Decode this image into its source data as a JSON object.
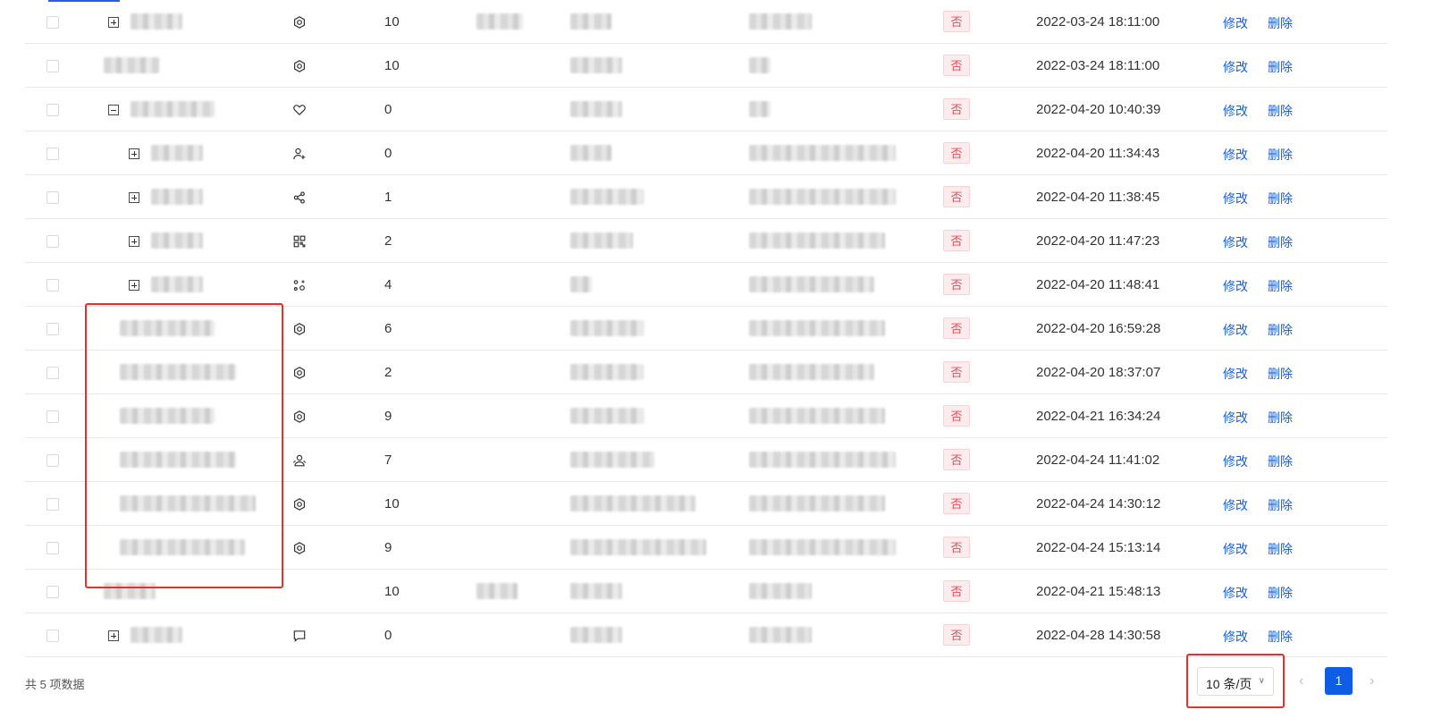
{
  "table": {
    "rows": [
      {
        "indent": 0,
        "expander": "plus",
        "icon": "settings-hex-icon",
        "num": "10",
        "badge": "否",
        "time": "2022-03-24 18:11:00",
        "edit": "修改",
        "del": "删除",
        "w1": 58,
        "w2": 52,
        "w3": 46,
        "w4": 70
      },
      {
        "indent": 0,
        "expander": "none",
        "icon": "settings-hex-icon",
        "num": "10",
        "badge": "否",
        "time": "2022-03-24 18:11:00",
        "edit": "修改",
        "del": "删除",
        "w1": 62,
        "w2": 0,
        "w3": 58,
        "w4": 24
      },
      {
        "indent": 0,
        "expander": "minus",
        "icon": "heart-icon",
        "num": "0",
        "badge": "否",
        "time": "2022-04-20 10:40:39",
        "edit": "修改",
        "del": "删除",
        "w1": 94,
        "w2": 0,
        "w3": 58,
        "w4": 24
      },
      {
        "indent": 1,
        "expander": "plus",
        "icon": "user-add-icon",
        "num": "0",
        "badge": "否",
        "time": "2022-04-20 11:34:43",
        "edit": "修改",
        "del": "删除",
        "w1": 58,
        "w2": 0,
        "w3": 46,
        "w4": 164
      },
      {
        "indent": 1,
        "expander": "plus",
        "icon": "share-icon",
        "num": "1",
        "badge": "否",
        "time": "2022-04-20 11:38:45",
        "edit": "修改",
        "del": "删除",
        "w1": 58,
        "w2": 0,
        "w3": 82,
        "w4": 164
      },
      {
        "indent": 1,
        "expander": "plus",
        "icon": "qrcode-icon",
        "num": "2",
        "badge": "否",
        "time": "2022-04-20 11:47:23",
        "edit": "修改",
        "del": "删除",
        "w1": 58,
        "w2": 0,
        "w3": 70,
        "w4": 152
      },
      {
        "indent": 1,
        "expander": "plus",
        "icon": "nodes-icon",
        "num": "4",
        "badge": "否",
        "time": "2022-04-20 11:48:41",
        "edit": "修改",
        "del": "删除",
        "w1": 58,
        "w2": 0,
        "w3": 24,
        "w4": 140
      },
      {
        "indent": 0,
        "expander": "none",
        "icon": "settings-hex-icon",
        "num": "6",
        "badge": "否",
        "time": "2022-04-20 16:59:28",
        "edit": "修改",
        "del": "删除",
        "w1": 106,
        "w2": 0,
        "w3": 82,
        "w4": 152
      },
      {
        "indent": 0,
        "expander": "none",
        "icon": "settings-hex-icon",
        "num": "2",
        "badge": "否",
        "time": "2022-04-20 18:37:07",
        "edit": "修改",
        "del": "删除",
        "w1": 130,
        "w2": 0,
        "w3": 82,
        "w4": 140
      },
      {
        "indent": 0,
        "expander": "none",
        "icon": "settings-hex-icon",
        "num": "9",
        "badge": "否",
        "time": "2022-04-21 16:34:24",
        "edit": "修改",
        "del": "删除",
        "w1": 106,
        "w2": 0,
        "w3": 82,
        "w4": 152
      },
      {
        "indent": 0,
        "expander": "none",
        "icon": "user-group-icon",
        "num": "7",
        "badge": "否",
        "time": "2022-04-24 11:41:02",
        "edit": "修改",
        "del": "删除",
        "w1": 130,
        "w2": 0,
        "w3": 94,
        "w4": 164
      },
      {
        "indent": 0,
        "expander": "none",
        "icon": "settings-hex-icon",
        "num": "10",
        "badge": "否",
        "time": "2022-04-24 14:30:12",
        "edit": "修改",
        "del": "删除",
        "w1": 152,
        "w2": 0,
        "w3": 140,
        "w4": 152
      },
      {
        "indent": 0,
        "expander": "none",
        "icon": "settings-hex-icon",
        "num": "9",
        "badge": "否",
        "time": "2022-04-24 15:13:14",
        "edit": "修改",
        "del": "删除",
        "w1": 140,
        "w2": 0,
        "w3": 152,
        "w4": 164
      },
      {
        "indent": 0,
        "expander": "none",
        "icon": "none",
        "num": "10",
        "badge": "否",
        "time": "2022-04-21 15:48:13",
        "edit": "修改",
        "del": "删除",
        "w1": 58,
        "w2": 46,
        "w3": 58,
        "w4": 70
      },
      {
        "indent": 0,
        "expander": "plus",
        "icon": "comment-icon",
        "num": "0",
        "badge": "否",
        "time": "2022-04-28 14:30:58",
        "edit": "修改",
        "del": "删除",
        "w1": 58,
        "w2": 0,
        "w3": 58,
        "w4": 70
      }
    ]
  },
  "footer": {
    "total": "共 5 项数据",
    "page_size": "10 条/页",
    "current_page": "1"
  },
  "colors": {
    "accent": "#0f5ce6",
    "link": "#1a5fd6",
    "badge_text": "#e34d59",
    "badge_bg": "#fdecee",
    "highlight_box": "#e2312f"
  }
}
